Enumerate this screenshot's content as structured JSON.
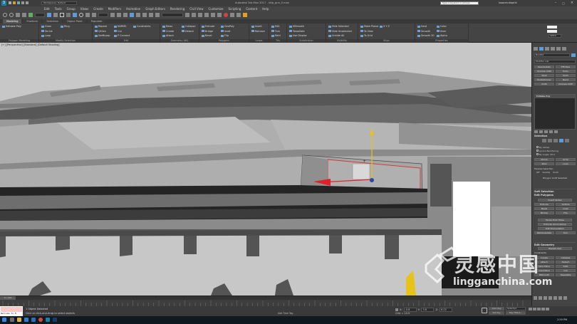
{
  "app": {
    "title": "Autodesk 3ds Max 2017 - ship_gun_0.max"
  },
  "titlebar": {
    "workspace_label": "Workspaces: Default",
    "search_placeholder": "Type a keyword or phrase",
    "user_label": "isaacmutiaphil"
  },
  "menu": [
    "Edit",
    "Tools",
    "Group",
    "Views",
    "Create",
    "Modifiers",
    "Animation",
    "Graph Editors",
    "Rendering",
    "Civil View",
    "Customize",
    "Scripting",
    "Content",
    "Help"
  ],
  "tabs": [
    {
      "label": "Modeling",
      "active": true
    },
    {
      "label": "Freeform",
      "active": false
    },
    {
      "label": "Selection",
      "active": false
    },
    {
      "label": "Object Paint",
      "active": false
    },
    {
      "label": "Populate",
      "active": false
    }
  ],
  "ribbon": {
    "groups": [
      {
        "label": "Polygon Modeling",
        "buttons": [
          "Editable Poly"
        ]
      },
      {
        "label": "Modify Selection",
        "buttons": [
          "Grow",
          "Shrink",
          "Loop",
          "Ring"
        ]
      },
      {
        "label": "Edit",
        "buttons": [
          "Repeat",
          "QSlice",
          "SwiftLoop",
          "NURMS",
          "Cut",
          "P Connect",
          "Constraints"
        ]
      },
      {
        "label": "Geometry (All)",
        "buttons": [
          "Relax",
          "Create",
          "Attach",
          "Collapse",
          "Detach"
        ]
      },
      {
        "label": "Polygons",
        "buttons": [
          "Extrude",
          "Bridge",
          "Bevel",
          "GeoPoly",
          "Inset",
          "Flip"
        ]
      },
      {
        "label": "Loops",
        "buttons": [
          "Insert",
          "Remove"
        ]
      },
      {
        "label": "Tris",
        "buttons": [
          "Edit",
          "Turn",
          "Retri"
        ]
      },
      {
        "label": "Subdivision",
        "buttons": [
          "MSmooth",
          "Tessellate",
          "Use Displac"
        ]
      },
      {
        "label": "Visibility",
        "buttons": [
          "Hide Selected",
          "Hide Unselected",
          "Unhide All"
        ]
      },
      {
        "label": "Align",
        "buttons": [
          "Make Planar",
          "To View",
          "To Grid",
          "X Y Z"
        ]
      },
      {
        "label": "Properties",
        "buttons": [
          "Hard",
          "Smooth",
          "Smooth 30",
          "Color",
          "Illum",
          "Alpha"
        ]
      }
    ],
    "alpha_value": "100.0"
  },
  "viewport": {
    "label": "[+] [Perspective] [Standard] [Default Shading]"
  },
  "right_panel": {
    "object_name": "Box001",
    "modifier_list_label": "Modifier List",
    "modifier_buttons": [
      "OpenSubdiv",
      "FFD Box",
      "Unwrap UVW",
      "Turbo",
      "Shell",
      "Push",
      "ProOptimizer",
      "Bend",
      "Cloth",
      "Unwrap UVW"
    ],
    "stack_item": "Editable Poly",
    "selection_title": "Selection",
    "selection_options": [
      "By Vertex",
      "Ignore Backfacing",
      "By Angle: 45.0"
    ],
    "selection_buttons": [
      "Shrink",
      "Grow",
      "Ring",
      "Loop"
    ],
    "preview_label": "Preview Selection",
    "preview_options": [
      "Off",
      "SubObj",
      "Multi"
    ],
    "selection_status": "Polygon 1118 Selected",
    "soft_selection_title": "Soft Selection",
    "edit_polygons_title": "Edit Polygons",
    "insert_vertex": "Insert Vertex",
    "edit_poly_buttons": [
      "Extrude",
      "Outline",
      "Bevel",
      "Inset",
      "Bridge",
      "Flip"
    ],
    "hinge_label": "Hinge From Edge",
    "extrude_spline_label": "Extrude Along Spline",
    "edit_tri_label": "Edit Triangulation",
    "retriangulate_label": "Retriangulate",
    "turn_label": "Turn",
    "edit_geometry_title": "Edit Geometry",
    "repeat_last": "Repeat Last",
    "constraints_label": "Constraints",
    "geo_buttons": [
      "Create",
      "Collapse",
      "Attach",
      "Detach",
      "Slice Plane",
      "Split",
      "QuickSlice",
      "Cut",
      "MSmooth",
      "Tessellate"
    ]
  },
  "timeline": {
    "frame_label": "0 / 100"
  },
  "status": {
    "maxscript_text": "Welcome to M",
    "selected_text": "1 Object Selected",
    "prompt_text": "Click or click-and-drag to select objects",
    "x_label": "X:",
    "x_value": "-0.6",
    "y_label": "Y:",
    "y_value": "3.6",
    "z_label": "Z:",
    "z_value": "6.02",
    "grid_label": "Grid = 10.0",
    "autokey_label": "Auto Key",
    "setkey_label": "Set Key",
    "selected_dropdown": "Selected",
    "key_filters": "Key Filters...",
    "add_time_tag": "Add Time Tag",
    "time": "2:59 PM"
  },
  "watermark": {
    "cn_text": "灵感中国",
    "url_text": "lingganchina.com"
  },
  "colors": {
    "accent": "#5d9bd6",
    "gizmo_yellow": "#e6c21a",
    "gizmo_red": "#e0202a",
    "selection_edge": "#d63030"
  }
}
